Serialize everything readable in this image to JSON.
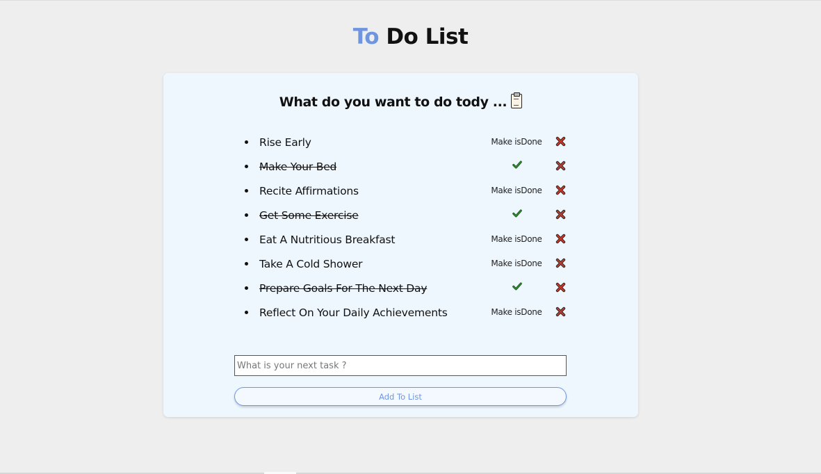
{
  "title": {
    "accent_word": "To",
    "rest": "Do List"
  },
  "card": {
    "heading": "What do you want to do tody ..."
  },
  "tasks": [
    {
      "text": "Rise Early",
      "done": false
    },
    {
      "text": "Make Your Bed",
      "done": true
    },
    {
      "text": "Recite Affirmations",
      "done": false
    },
    {
      "text": "Get Some Exercise",
      "done": true
    },
    {
      "text": "Eat A Nutritious Breakfast",
      "done": false
    },
    {
      "text": "Take A Cold Shower",
      "done": false
    },
    {
      "text": "Prepare Goals For The Next Day",
      "done": true
    },
    {
      "text": "Reflect On Your Daily Achievements",
      "done": false
    }
  ],
  "actions": {
    "make_done_label": "Make isDone"
  },
  "input": {
    "value": "",
    "placeholder": "What is your next task ?"
  },
  "add_button": {
    "label": "Add To List"
  },
  "icons": {
    "clipboard": "clipboard-icon",
    "check": "check-icon",
    "delete": "cross-mark-icon"
  },
  "colors": {
    "accent": "#6f95e0",
    "check": "#2e8b2e",
    "delete": "#c0392b"
  }
}
